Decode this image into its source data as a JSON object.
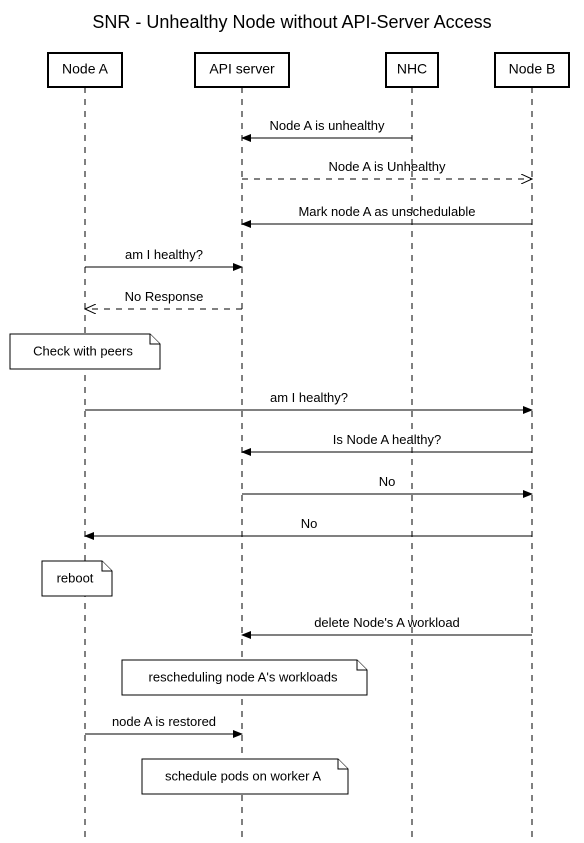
{
  "title": "SNR - Unhealthy Node without API-Server Access",
  "actors": {
    "nodeA": "Node A",
    "apiServer": "API server",
    "nhc": "NHC",
    "nodeB": "Node B"
  },
  "messages": {
    "m1": "Node A is unhealthy",
    "m2": "Node A is Unhealthy",
    "m3": "Mark node A as unschedulable",
    "m4": "am I healthy?",
    "m5": "No Response",
    "m6": "am I healthy?",
    "m7": "Is Node A healthy?",
    "m8": "No",
    "m9": "No",
    "m10": "delete Node's A workload",
    "m11": "node A is restored"
  },
  "notes": {
    "n1": "Check with peers",
    "n2": "reboot",
    "n3": "rescheduling node A's workloads",
    "n4": "schedule pods on worker A"
  }
}
